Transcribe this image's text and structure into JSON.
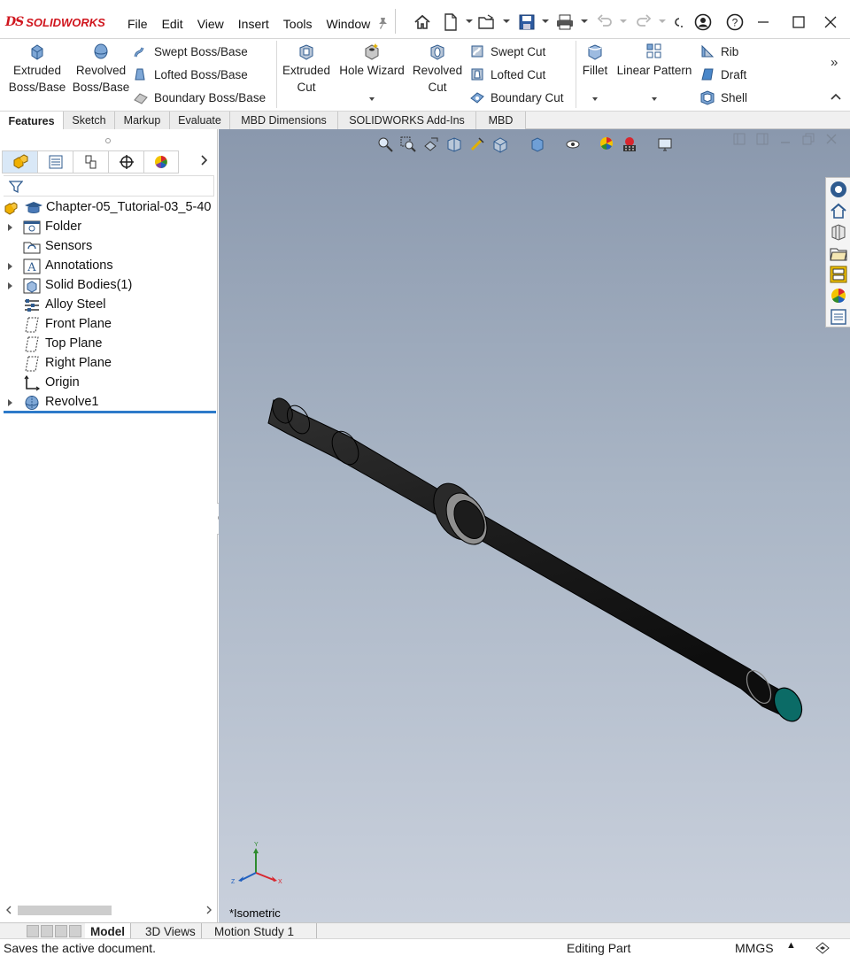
{
  "app": {
    "brand": "SOLIDWORKS",
    "brand_mark": "DS"
  },
  "menubar": {
    "items": [
      "File",
      "Edit",
      "View",
      "Insert",
      "Tools",
      "Window"
    ]
  },
  "quick_access": {
    "icons": [
      "home-icon",
      "new-document-icon",
      "open-icon",
      "save-icon",
      "print-icon",
      "undo-icon",
      "redo-icon",
      "select-icon",
      "user-icon",
      "help-icon"
    ]
  },
  "window_controls": [
    "minimize",
    "maximize",
    "close"
  ],
  "ribbon": {
    "extruded_boss": "Extruded Boss/Base",
    "extruded_boss_l1": "Extruded",
    "extruded_boss_l2": "Boss/Base",
    "revolved_boss_l1": "Revolved",
    "revolved_boss_l2": "Boss/Base",
    "swept_boss": "Swept Boss/Base",
    "lofted_boss": "Lofted Boss/Base",
    "boundary_boss": "Boundary Boss/Base",
    "extruded_cut_l1": "Extruded",
    "extruded_cut_l2": "Cut",
    "hole_wizard": "Hole Wizard",
    "revolved_cut_l1": "Revolved",
    "revolved_cut_l2": "Cut",
    "swept_cut": "Swept Cut",
    "lofted_cut": "Lofted Cut",
    "boundary_cut": "Boundary Cut",
    "fillet": "Fillet",
    "linear_pattern": "Linear Pattern",
    "rib": "Rib",
    "draft": "Draft",
    "shell": "Shell"
  },
  "command_tabs": [
    "Features",
    "Sketch",
    "Markup",
    "Evaluate",
    "MBD Dimensions",
    "SOLIDWORKS Add-Ins",
    "MBD"
  ],
  "active_command_tab": "Features",
  "feature_manager": {
    "root": "Chapter-05_Tutorial-03_5-40",
    "nodes": [
      {
        "label": "Folder",
        "icon": "folder-icon",
        "expandable": true
      },
      {
        "label": "Sensors",
        "icon": "sensors-icon",
        "expandable": false
      },
      {
        "label": "Annotations",
        "icon": "annotations-icon",
        "expandable": true
      },
      {
        "label": "Solid Bodies(1)",
        "icon": "solid-bodies-icon",
        "expandable": true
      },
      {
        "label": "Alloy Steel",
        "icon": "material-icon",
        "expandable": false
      },
      {
        "label": "Front Plane",
        "icon": "plane-icon",
        "expandable": false
      },
      {
        "label": "Top Plane",
        "icon": "plane-icon",
        "expandable": false
      },
      {
        "label": "Right Plane",
        "icon": "plane-icon",
        "expandable": false
      },
      {
        "label": "Origin",
        "icon": "origin-icon",
        "expandable": false
      },
      {
        "label": "Revolve1",
        "icon": "revolve-icon",
        "expandable": true
      }
    ]
  },
  "viewport": {
    "view_name": "*Isometric",
    "background_top": "#8a98ad",
    "background_bottom": "#c9d0dc",
    "part_color": "#1e1e1e",
    "end_face_color": "#0b6b66",
    "triad": {
      "x": "X",
      "y": "Y",
      "z": "Z"
    }
  },
  "bottom_tabs": [
    "Model",
    "3D Views",
    "Motion Study 1"
  ],
  "active_bottom_tab": "Model",
  "status": {
    "message": "Saves the active document.",
    "mode": "Editing Part",
    "units": "MMGS"
  }
}
